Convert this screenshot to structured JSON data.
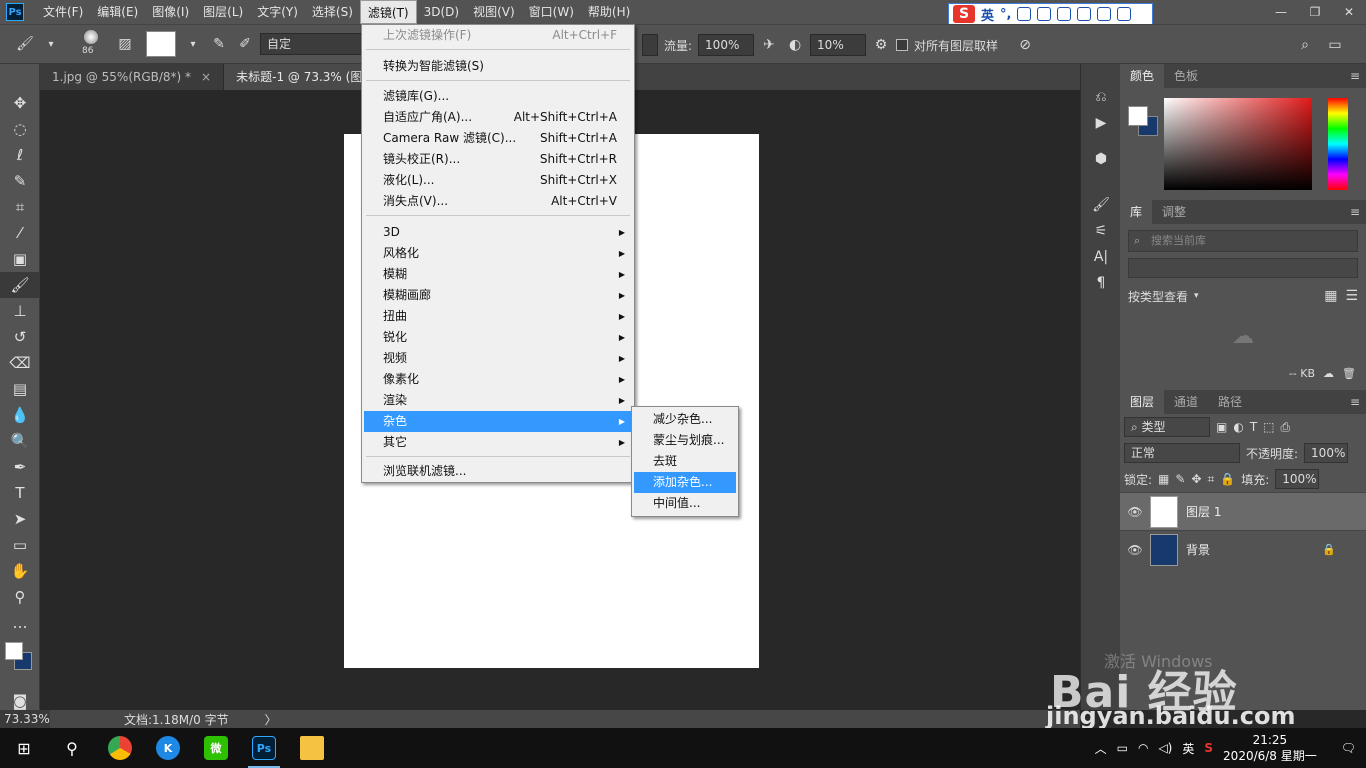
{
  "menubar": {
    "logo": "Ps",
    "items": [
      "文件(F)",
      "编辑(E)",
      "图像(I)",
      "图层(L)",
      "文字(Y)",
      "选择(S)",
      "滤镜(T)",
      "3D(D)",
      "视图(V)",
      "窗口(W)",
      "帮助(H)"
    ],
    "active_index": 6
  },
  "ime": {
    "logo": "S",
    "lang": "英",
    "punct": "°,"
  },
  "options": {
    "brush_size": "86",
    "preset": "自定",
    "flow_label": "流量:",
    "flow_value": "100%",
    "angle_value": "10%",
    "sample_all_label": "对所有图层取样"
  },
  "tabs": [
    {
      "label": "1.jpg @ 55%(RGB/8*) *",
      "close": "×"
    },
    {
      "label": "未标题-1 @ 73.3% (图层 1,",
      "close": ""
    }
  ],
  "filter_menu": {
    "items": [
      {
        "label": "上次滤镜操作(F)",
        "shortcut": "Alt+Ctrl+F",
        "disabled": true
      },
      {
        "label": "转换为智能滤镜(S)",
        "shortcut": ""
      },
      {
        "label": "滤镜库(G)...",
        "shortcut": ""
      },
      {
        "label": "自适应广角(A)...",
        "shortcut": "Alt+Shift+Ctrl+A"
      },
      {
        "label": "Camera Raw 滤镜(C)...",
        "shortcut": "Shift+Ctrl+A"
      },
      {
        "label": "镜头校正(R)...",
        "shortcut": "Shift+Ctrl+R"
      },
      {
        "label": "液化(L)...",
        "shortcut": "Shift+Ctrl+X"
      },
      {
        "label": "消失点(V)...",
        "shortcut": "Alt+Ctrl+V"
      },
      {
        "label": "3D"
      },
      {
        "label": "风格化"
      },
      {
        "label": "模糊"
      },
      {
        "label": "模糊画廊"
      },
      {
        "label": "扭曲"
      },
      {
        "label": "锐化"
      },
      {
        "label": "视频"
      },
      {
        "label": "像素化"
      },
      {
        "label": "渲染"
      },
      {
        "label": "杂色"
      },
      {
        "label": "其它"
      },
      {
        "label": "浏览联机滤镜..."
      }
    ],
    "arrow": "▶"
  },
  "noise_submenu": {
    "items": [
      "减少杂色...",
      "蒙尘与划痕...",
      "去斑",
      "添加杂色...",
      "中间值..."
    ],
    "highlighted_index": 3
  },
  "status": {
    "zoom": "73.33%",
    "doc": "文档:1.18M/0 字节",
    "arrow": "〉"
  },
  "color_panel": {
    "tabs": [
      "颜色",
      "色板"
    ],
    "fg": "#ffffff",
    "bg": "#17396b"
  },
  "library_panel": {
    "tabs": [
      "库",
      "调整"
    ],
    "search_placeholder": "搜索当前库",
    "view_label": "按类型查看",
    "size": "-- KB"
  },
  "layers_panel": {
    "tabs": [
      "图层",
      "通道",
      "路径"
    ],
    "filter": "类型",
    "blend": "正常",
    "opacity_label": "不透明度:",
    "opacity": "100%",
    "lock_label": "锁定:",
    "fill_label": "填充:",
    "fill": "100%",
    "layers": [
      {
        "name": "图层 1",
        "thumb": "#ffffff",
        "selected": true
      },
      {
        "name": "背景",
        "thumb": "#17396b",
        "selected": false
      }
    ]
  },
  "watermark": {
    "activate": "激活 Windows",
    "baidu": "Bai 经验",
    "url": "jingyan.baidu.com"
  },
  "taskbar": {
    "apps": [
      {
        "name": "chrome",
        "label": "",
        "color": "#e8453c"
      },
      {
        "name": "k-app",
        "label": "K",
        "color": "#1e88e5"
      },
      {
        "name": "wechat",
        "label": "微",
        "color": "#2dc100"
      },
      {
        "name": "photoshop",
        "label": "Ps",
        "color": "#001e36"
      },
      {
        "name": "explorer",
        "label": "",
        "color": "#f5c242"
      }
    ],
    "tray_lang": "英",
    "time": "21:25",
    "date": "2020/6/8 星期一"
  }
}
